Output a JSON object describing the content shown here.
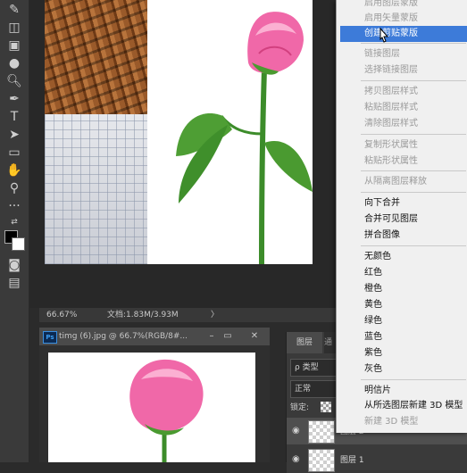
{
  "status_bar": {
    "zoom": "66.67%",
    "doc_info": "文档:1.83M/3.93M",
    "arrow": "〉"
  },
  "doc_window": {
    "badge": "Ps",
    "title": "timg (6).jpg @ 66.7%(RGB/8#...",
    "minimize": "–",
    "maximize": "▭",
    "close": "✕"
  },
  "layers_panel": {
    "tabs": [
      "图层",
      "通"
    ],
    "filter_label": "ρ 类型",
    "blend_mode": "正常",
    "lock_label": "锁定:",
    "layers": [
      "图层 2",
      "图层 1"
    ]
  },
  "context_menu": {
    "items": [
      {
        "label": "启用图层蒙版",
        "disabled": true
      },
      {
        "label": "启用矢量蒙版",
        "disabled": true
      },
      {
        "label": "创建剪贴蒙版",
        "disabled": false,
        "highlighted": true
      },
      {
        "label": "链接图层",
        "disabled": true
      },
      {
        "label": "选择链接图层",
        "disabled": true
      },
      {
        "label": "拷贝图层样式",
        "disabled": true
      },
      {
        "label": "粘贴图层样式",
        "disabled": true
      },
      {
        "label": "清除图层样式",
        "disabled": true
      },
      {
        "label": "复制形状属性",
        "disabled": true
      },
      {
        "label": "粘贴形状属性",
        "disabled": true
      },
      {
        "label": "从隔离图层释放",
        "disabled": true
      },
      {
        "label": "向下合并",
        "disabled": false
      },
      {
        "label": "合并可见图层",
        "disabled": false
      },
      {
        "label": "拼合图像",
        "disabled": false
      },
      {
        "label": "无颜色",
        "disabled": false
      },
      {
        "label": "红色",
        "disabled": false
      },
      {
        "label": "橙色",
        "disabled": false
      },
      {
        "label": "黄色",
        "disabled": false
      },
      {
        "label": "绿色",
        "disabled": false
      },
      {
        "label": "蓝色",
        "disabled": false
      },
      {
        "label": "紫色",
        "disabled": false
      },
      {
        "label": "灰色",
        "disabled": false
      },
      {
        "label": "明信片",
        "disabled": false
      },
      {
        "label": "从所选图层新建 3D 模型",
        "disabled": false
      },
      {
        "label": "新建 3D 模型",
        "disabled": true
      }
    ]
  },
  "toolbar": {
    "tools": [
      "brush-tool-icon",
      "eraser-icon",
      "gradient-icon",
      "blur-drop-icon",
      "dodge-icon",
      "pen-icon",
      "type-icon",
      "path-select-icon",
      "rectangle-icon",
      "hand-icon",
      "zoom-icon",
      "more-icon",
      "swap-colors-icon",
      "foreground-color-icon",
      "quick-mask-icon",
      "screen-mode-icon"
    ]
  },
  "colors": {
    "menu_highlight": "#3d7bd9",
    "rose_pink": "#e8559a",
    "leaf_green": "#3f9a2e"
  }
}
